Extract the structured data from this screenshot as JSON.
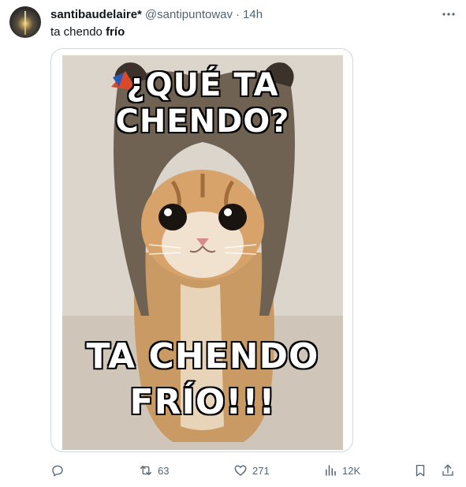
{
  "author": {
    "display_name": "santibaudelaire*",
    "handle": "@santipuntowav",
    "separator": "·",
    "time": "14h"
  },
  "tweet": {
    "text_plain": "ta chendo ",
    "text_bold": "frío"
  },
  "media": {
    "top_text_line1": "¿QUÉ TA",
    "top_text_line2": "CHENDO?",
    "bottom_text_line1": "TA CHENDO",
    "bottom_text_line2": "FRÍO!!!"
  },
  "actions": {
    "reply_icon": "reply-icon",
    "retweet_icon": "retweet-icon",
    "retweet_count": "63",
    "like_icon": "heart-icon",
    "like_count": "271",
    "views_icon": "views-icon",
    "views_count": "12K",
    "bookmark_icon": "bookmark-icon",
    "share_icon": "share-icon"
  },
  "colors": {
    "text_primary": "#0f1419",
    "text_secondary": "#536471",
    "border": "#cfd9de"
  }
}
